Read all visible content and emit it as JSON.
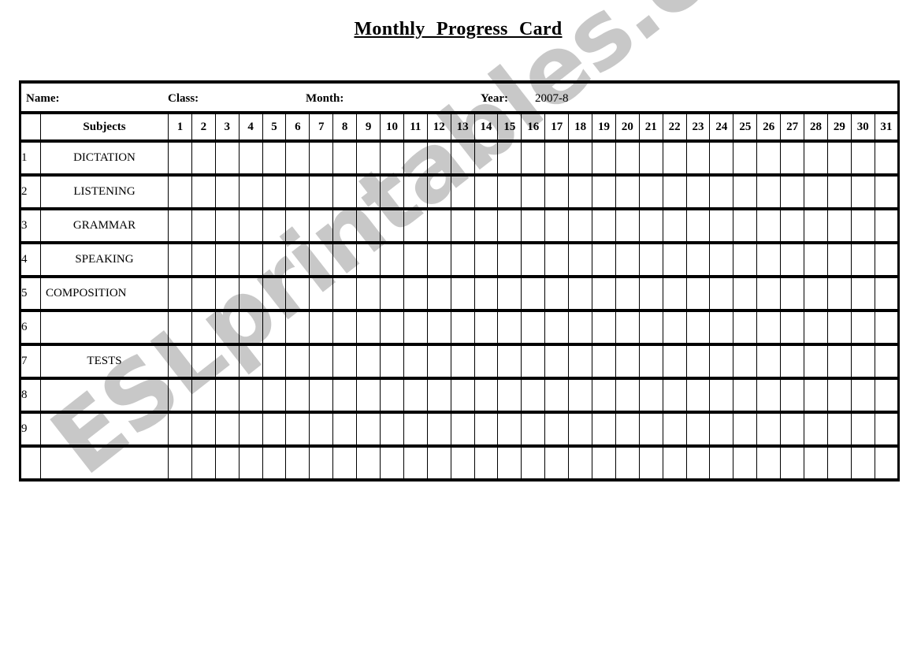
{
  "title": "Monthly   Progress   Card",
  "watermark": "ESLprintables.com",
  "info": {
    "name_label": "Name:",
    "class_label": "Class:",
    "month_label": "Month:",
    "year_label": "Year:",
    "year_value": "2007-8"
  },
  "header": {
    "subjects_label": "Subjects",
    "days": [
      "1",
      "2",
      "3",
      "4",
      "5",
      "6",
      "7",
      "8",
      "9",
      "10",
      "11",
      "12",
      "13",
      "14",
      "15",
      "16",
      "17",
      "18",
      "19",
      "20",
      "21",
      "22",
      "23",
      "24",
      "25",
      "26",
      "27",
      "28",
      "29",
      "30",
      "31"
    ]
  },
  "rows": [
    {
      "num": "1",
      "subject": "DICTATION",
      "align": "center"
    },
    {
      "num": "2",
      "subject": "LISTENING",
      "align": "center"
    },
    {
      "num": "3",
      "subject": "GRAMMAR",
      "align": "center"
    },
    {
      "num": "4",
      "subject": "SPEAKING",
      "align": "center"
    },
    {
      "num": "5",
      "subject": "COMPOSITION",
      "align": "left"
    },
    {
      "num": "6",
      "subject": "",
      "align": "center"
    },
    {
      "num": "7",
      "subject": "TESTS",
      "align": "center"
    },
    {
      "num": "8",
      "subject": "",
      "align": "center"
    },
    {
      "num": "9",
      "subject": "",
      "align": "center"
    },
    {
      "num": "",
      "subject": "",
      "align": "center"
    }
  ]
}
